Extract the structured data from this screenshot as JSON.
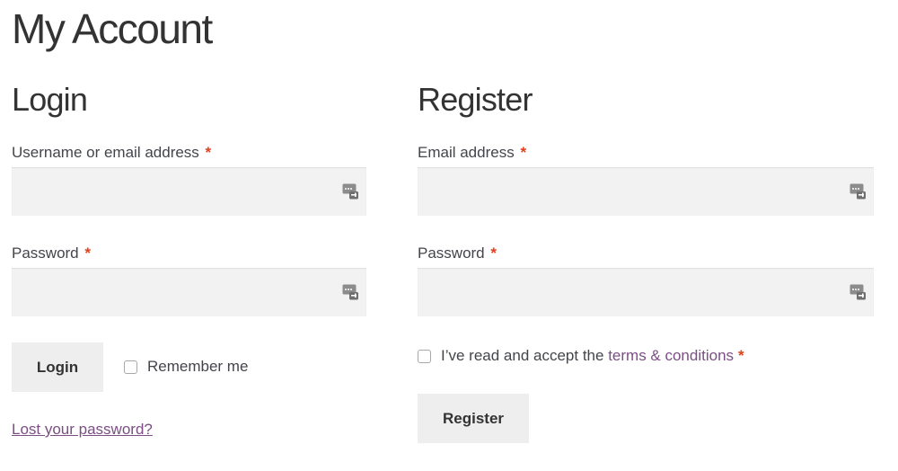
{
  "page": {
    "title": "My Account"
  },
  "login": {
    "heading": "Login",
    "username_label": "Username or email address",
    "username_value": "",
    "password_label": "Password",
    "password_value": "",
    "required_mark": "*",
    "submit_label": "Login",
    "remember_label": "Remember me",
    "remember_checked": false,
    "lost_password_label": "Lost your password?"
  },
  "register": {
    "heading": "Register",
    "email_label": "Email address",
    "email_value": "",
    "password_label": "Password",
    "password_value": "",
    "required_mark": "*",
    "terms_prefix": "I’ve read and accept the ",
    "terms_link": "terms & conditions",
    "terms_checked": false,
    "submit_label": "Register"
  },
  "icons": {
    "field_autofill": "password-manager-key-icon"
  },
  "colors": {
    "link": "#7b4e84",
    "required": "#e2401c",
    "input_bg": "#f2f2f2",
    "button_bg": "#eeeeee"
  }
}
